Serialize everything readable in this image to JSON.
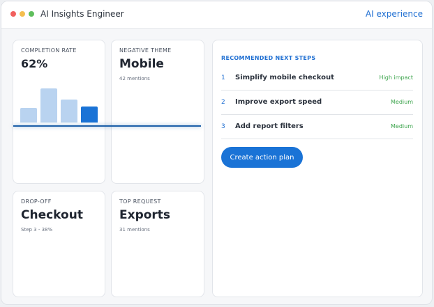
{
  "app": {
    "title": "AI Insights Engineer",
    "header_link": "AI experience"
  },
  "cards": {
    "completion": {
      "label": "COMPLETION RATE",
      "value": "62%"
    },
    "negative_theme": {
      "label": "NEGATIVE THEME",
      "value": "Mobile",
      "sub": "42 mentions"
    },
    "drop_off": {
      "label": "DROP-OFF",
      "value": "Checkout",
      "sub": "Step 3 - 38%"
    },
    "top_request": {
      "label": "TOP REQUEST",
      "value": "Exports",
      "sub": "31 mentions"
    }
  },
  "chart_data": {
    "type": "bar",
    "values": [
      21,
      49,
      33,
      23
    ],
    "colors": [
      "#b9d3f0",
      "#b9d3f0",
      "#b9d3f0",
      "#1a73d6"
    ]
  },
  "next_steps": {
    "title": "RECOMMENDED NEXT STEPS",
    "items": [
      {
        "num": "1",
        "text": "Simplify mobile checkout",
        "impact": "High impact"
      },
      {
        "num": "2",
        "text": "Improve export speed",
        "impact": "Medium"
      },
      {
        "num": "3",
        "text": "Add report filters",
        "impact": "Medium"
      }
    ],
    "button_label": "Create action plan"
  },
  "colors": {
    "accent": "#1a73d6",
    "impact_green": "#3aa34a"
  }
}
